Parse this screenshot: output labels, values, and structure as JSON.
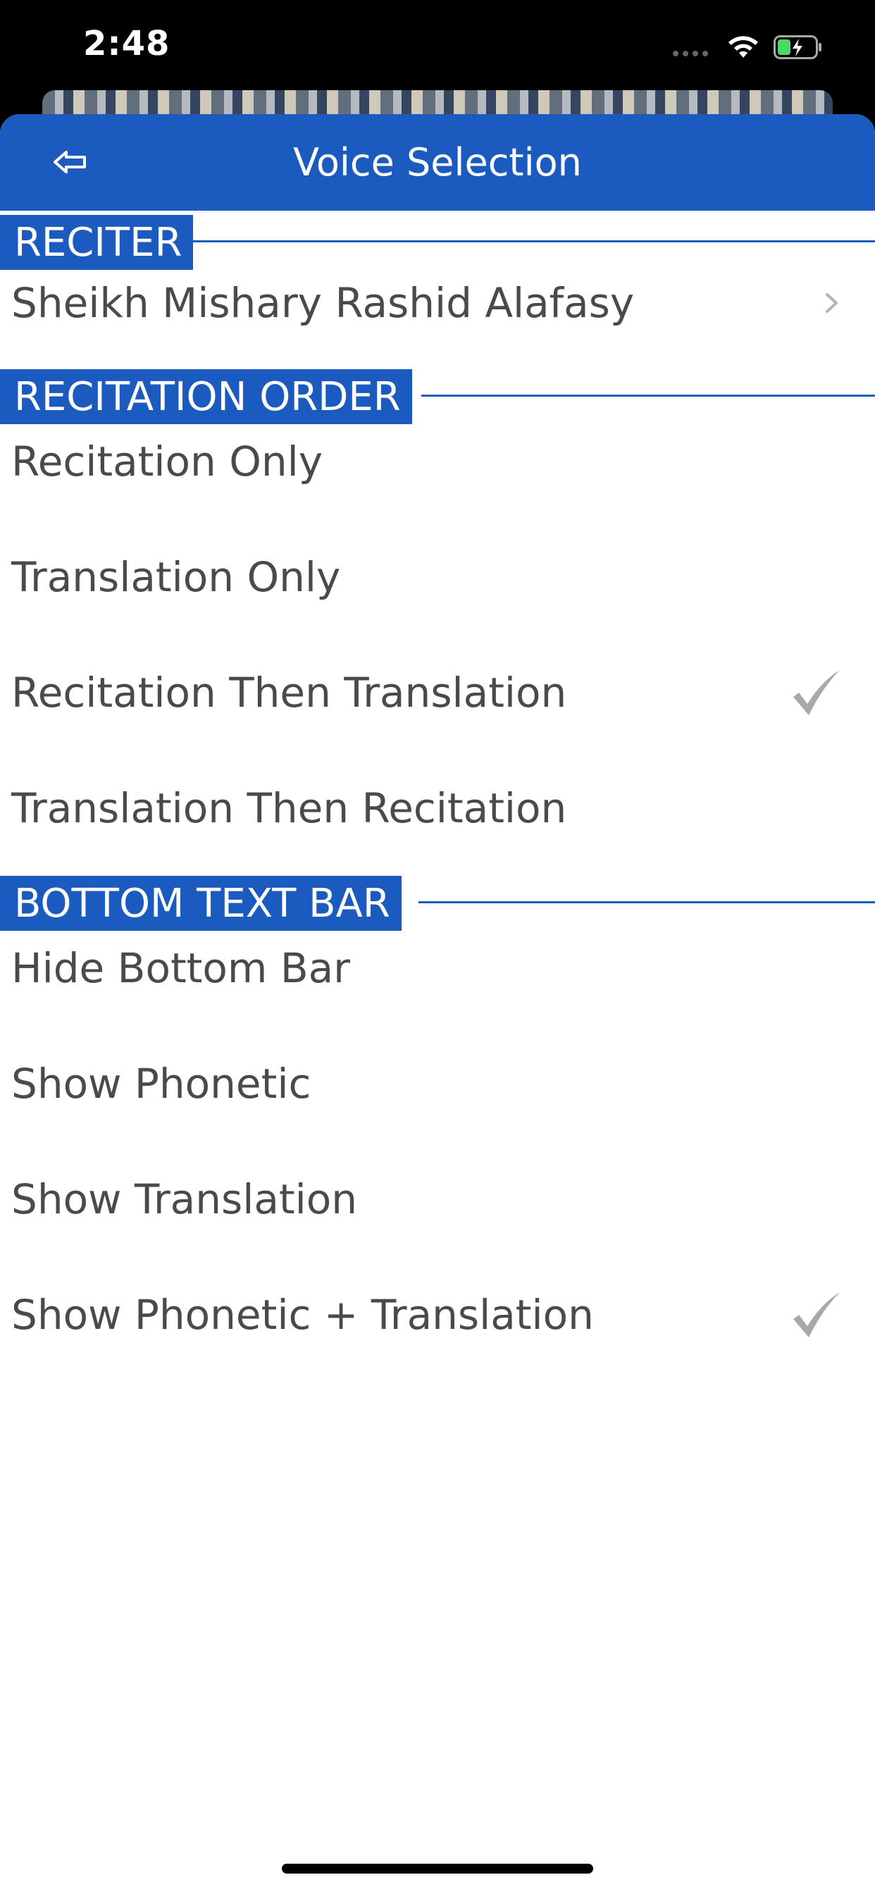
{
  "status_bar": {
    "time": "2:48"
  },
  "nav": {
    "title": "Voice Selection"
  },
  "sections": {
    "reciter": {
      "header": "RECITER",
      "items": [
        {
          "label": "Sheikh Mishary Rashid Alafasy",
          "accessory": "chevron-right-icon"
        }
      ]
    },
    "recitation_order": {
      "header": "RECITATION ORDER",
      "items": [
        {
          "label": "Recitation Only",
          "selected": false
        },
        {
          "label": "Translation Only",
          "selected": false
        },
        {
          "label": "Recitation Then Translation",
          "selected": true
        },
        {
          "label": "Translation Then Recitation",
          "selected": false
        }
      ]
    },
    "bottom_text_bar": {
      "header": "BOTTOM TEXT BAR",
      "items": [
        {
          "label": "Hide Bottom Bar",
          "selected": false
        },
        {
          "label": "Show Phonetic",
          "selected": false
        },
        {
          "label": "Show Translation",
          "selected": false
        },
        {
          "label": "Show Phonetic + Translation",
          "selected": true
        }
      ]
    }
  },
  "colors": {
    "accent": "#1b5bbf",
    "text": "#4a4a4a",
    "checkmark": "#a8a8a8"
  }
}
